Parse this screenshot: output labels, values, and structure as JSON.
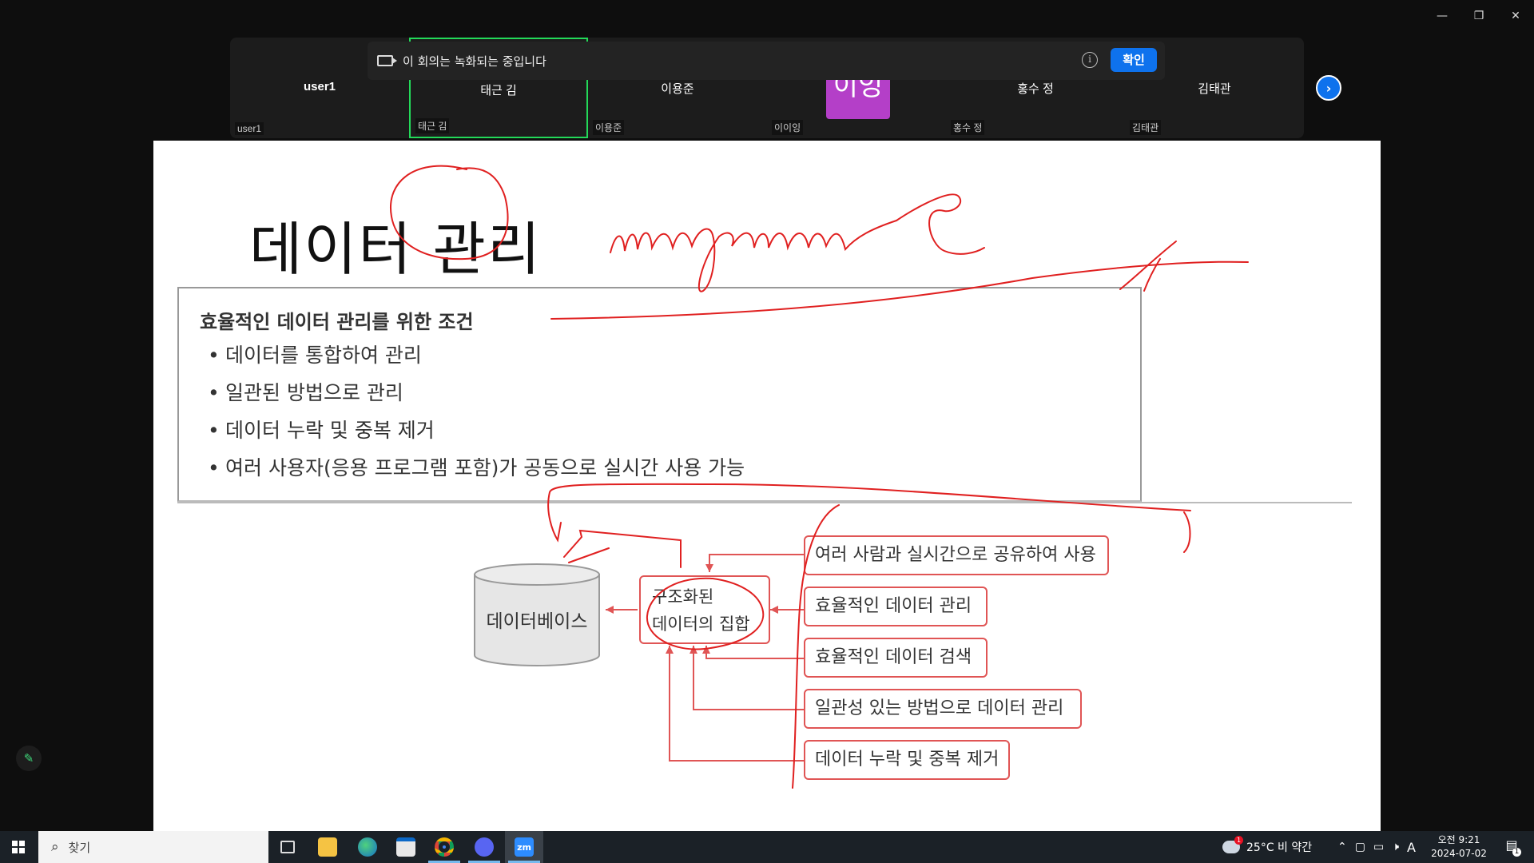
{
  "window": {
    "minimize": "—",
    "restore": "❐",
    "close": "✕"
  },
  "gallery": {
    "tiles": [
      {
        "center": "user1",
        "corner": "user1"
      },
      {
        "center": "태근 김",
        "corner": "태근 김"
      },
      {
        "center": "이용준",
        "corner": "이용준"
      },
      {
        "center": "",
        "corner": "이이잉"
      },
      {
        "center": "홍수 정",
        "corner": "홍수 정"
      },
      {
        "center": "김태관",
        "corner": "김태관"
      }
    ],
    "avatar_text": "이잉",
    "next": "›"
  },
  "recording": {
    "text": "이 회의는 녹화되는 중입니다",
    "info": "i",
    "ok": "확인"
  },
  "slide": {
    "title": "데이터 관리",
    "conditions_title": "효율적인 데이터 관리를 위한 조건",
    "conditions": [
      "데이터를 통합하여 관리",
      "일관된 방법으로 관리",
      "데이터 누락 및 중복 제거",
      "여러 사용자(응용 프로그램 포함)가 공동으로 실시간 사용 가능"
    ],
    "database": "데이터베이스",
    "center_lines": [
      "구조화된",
      "데이터의 집합"
    ],
    "features": [
      "여러 사람과 실시간으로 공유하여 사용",
      "효율적인 데이터 관리",
      "효율적인 데이터 검색",
      "일관성 있는 방법으로 데이터 관리",
      "데이터 누락 및 중복 제거"
    ],
    "handwriting": "management"
  },
  "taskbar": {
    "search_placeholder": "찾기",
    "apps": [
      "task-view",
      "file-explorer",
      "edge",
      "store",
      "chrome",
      "discord",
      "zoom"
    ],
    "zoom_label": "zm",
    "weather": "25°C  비 약간",
    "weather_badge": "1",
    "ime": "A",
    "time": "오전 9:21",
    "date": "2024-07-02",
    "notif_count": "1"
  },
  "colors": {
    "ink": "#e02020",
    "accent": "#0e72ed",
    "active_speaker": "#23d959",
    "avatar": "#b43fc8"
  }
}
